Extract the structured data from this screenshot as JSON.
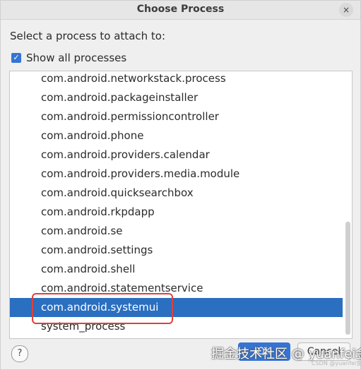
{
  "dialog": {
    "title": "Choose Process",
    "close_label": "×",
    "prompt": "Select a process to attach to:",
    "show_all_label": "Show all processes",
    "show_all_checked": true,
    "checkbox_glyph": "✓"
  },
  "processes": [
    "com.android.networkstack.process",
    "com.android.packageinstaller",
    "com.android.permissioncontroller",
    "com.android.phone",
    "com.android.providers.calendar",
    "com.android.providers.media.module",
    "com.android.quicksearchbox",
    "com.android.rkpdapp",
    "com.android.se",
    "com.android.settings",
    "com.android.shell",
    "com.android.statementservice",
    "com.android.systemui",
    "system_process"
  ],
  "selected_index": 12,
  "buttons": {
    "help_label": "?",
    "ok_label": "OK",
    "cancel_label": "Cancel"
  },
  "watermark": {
    "main": "掘金技术社区 @ yuanfei金",
    "sub": "CSDN @yuanfei金"
  },
  "colors": {
    "selection": "#2a6fc0",
    "highlight_box": "#e0403a",
    "accent": "#3574d4"
  }
}
